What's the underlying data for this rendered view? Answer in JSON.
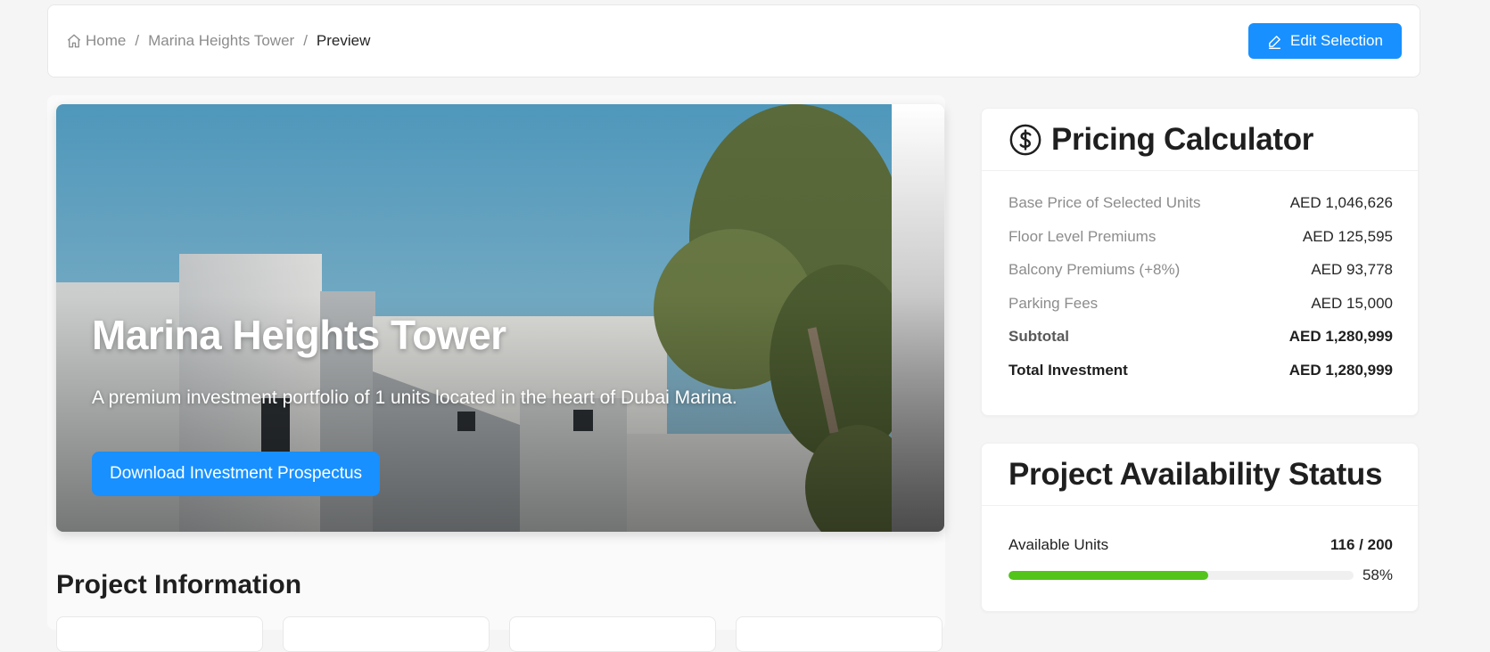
{
  "breadcrumb": {
    "home": "Home",
    "project": "Marina Heights Tower",
    "current": "Preview",
    "separator": "/"
  },
  "toolbar": {
    "edit_label": "Edit Selection"
  },
  "hero": {
    "title": "Marina Heights Tower",
    "subtitle": "A premium investment portfolio of 1 units located in the heart of Dubai Marina.",
    "cta_label": "Download Investment Prospectus"
  },
  "project_info": {
    "title": "Project Information"
  },
  "pricing": {
    "title": "Pricing Calculator",
    "icon": "dollar-circle-icon",
    "rows": [
      {
        "label": "Base Price of Selected Units",
        "value": "AED 1,046,626"
      },
      {
        "label": "Floor Level Premiums",
        "value": "AED 125,595"
      },
      {
        "label": "Balcony Premiums (+8%)",
        "value": "AED 93,778"
      },
      {
        "label": "Parking Fees",
        "value": "AED 15,000"
      }
    ],
    "subtotal": {
      "label": "Subtotal",
      "value": "AED 1,280,999"
    },
    "total": {
      "label": "Total Investment",
      "value": "AED 1,280,999"
    }
  },
  "availability": {
    "title": "Project Availability Status",
    "label": "Available Units",
    "count": "116 / 200",
    "percent_label": "58%",
    "progress": 0.58
  },
  "colors": {
    "primary": "#1890ff",
    "success": "#52c41a",
    "background": "#f5f5f5"
  }
}
